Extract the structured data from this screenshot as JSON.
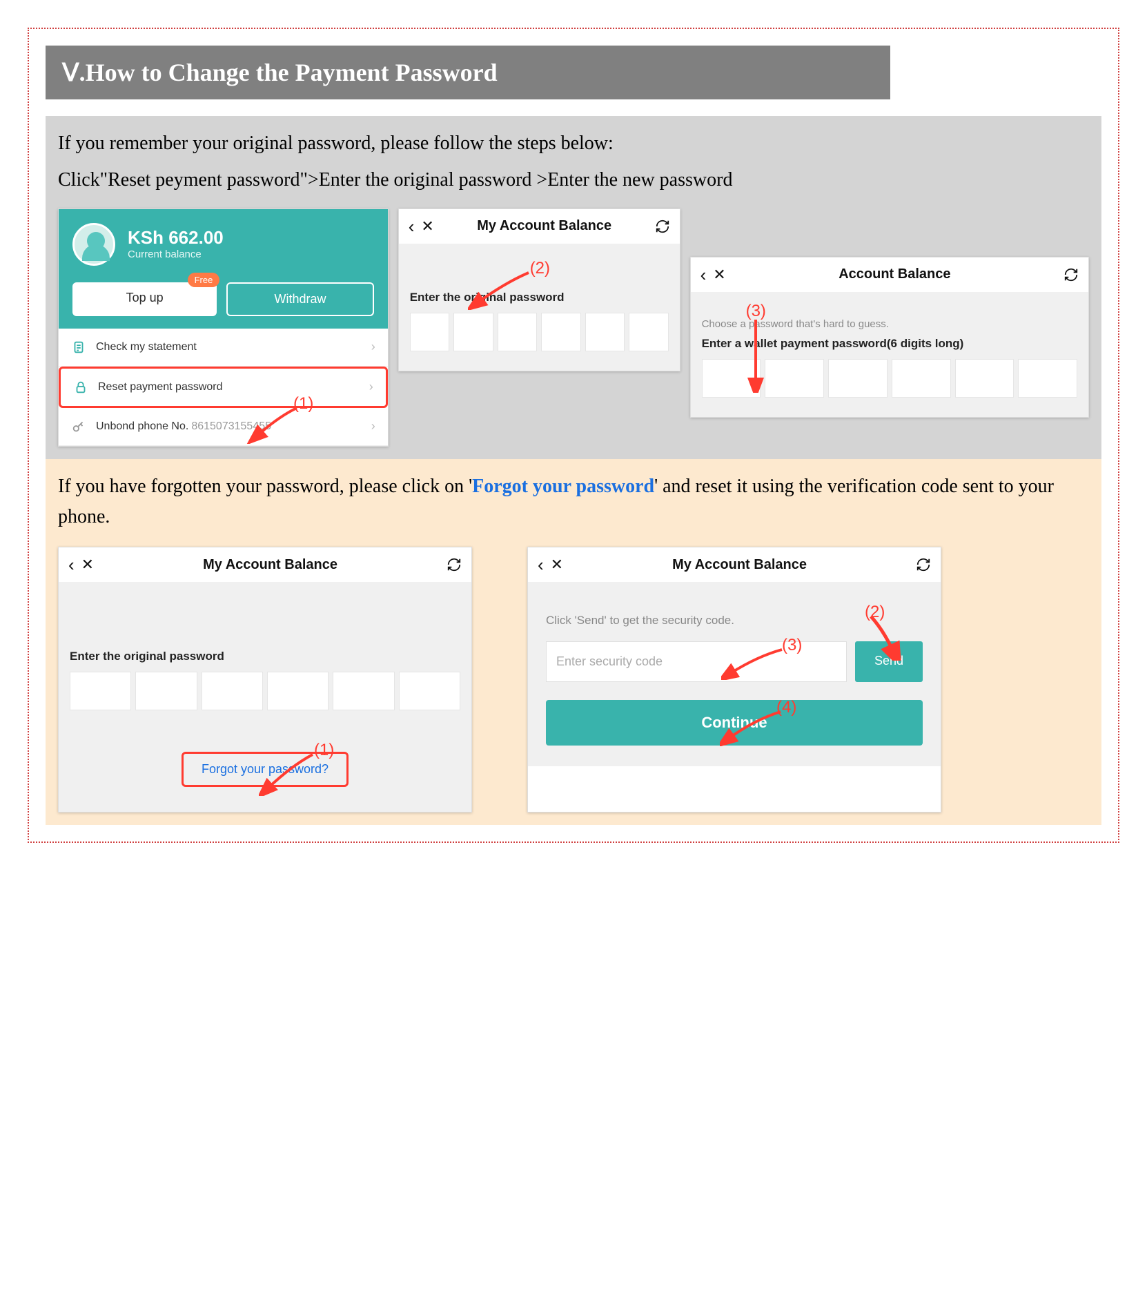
{
  "title": "Ⅴ.How to Change the Payment Password",
  "intro1": "If you remember your original password, please follow the steps below:",
  "intro2": "Click\"Reset peyment password\">Enter the original password >Enter the new password",
  "wallet": {
    "balance": "KSh 662.00",
    "balance_sub": "Current balance",
    "topup": "Top up",
    "free_badge": "Free",
    "withdraw": "Withdraw",
    "item_statement": "Check my statement",
    "item_reset": "Reset payment password",
    "item_unbond_prefix": "Unbond phone No. ",
    "phone_number": "8615073155455"
  },
  "s2": {
    "title": "My Account Balance",
    "label": "Enter the original password"
  },
  "s3": {
    "title": "Account Balance",
    "sub": "Choose a password that's hard to guess.",
    "label": "Enter a wallet payment password(6 digits long)"
  },
  "beige_intro_a": "If you have forgotten your password, please click on '",
  "beige_link": "Forgot your password",
  "beige_intro_b": "' and reset it using the verification code sent to your phone.",
  "s4": {
    "title": "My Account Balance",
    "label": "Enter the original password",
    "forgot": "Forgot your password?"
  },
  "s5": {
    "title": "My Account Balance",
    "hint": "Click 'Send' to get the security code.",
    "placeholder": "Enter security code",
    "send": "Send",
    "continue": "Continue"
  },
  "anno": {
    "a1": "(1)",
    "a2": "(2)",
    "a3": "(3)",
    "a4": "(4)"
  }
}
